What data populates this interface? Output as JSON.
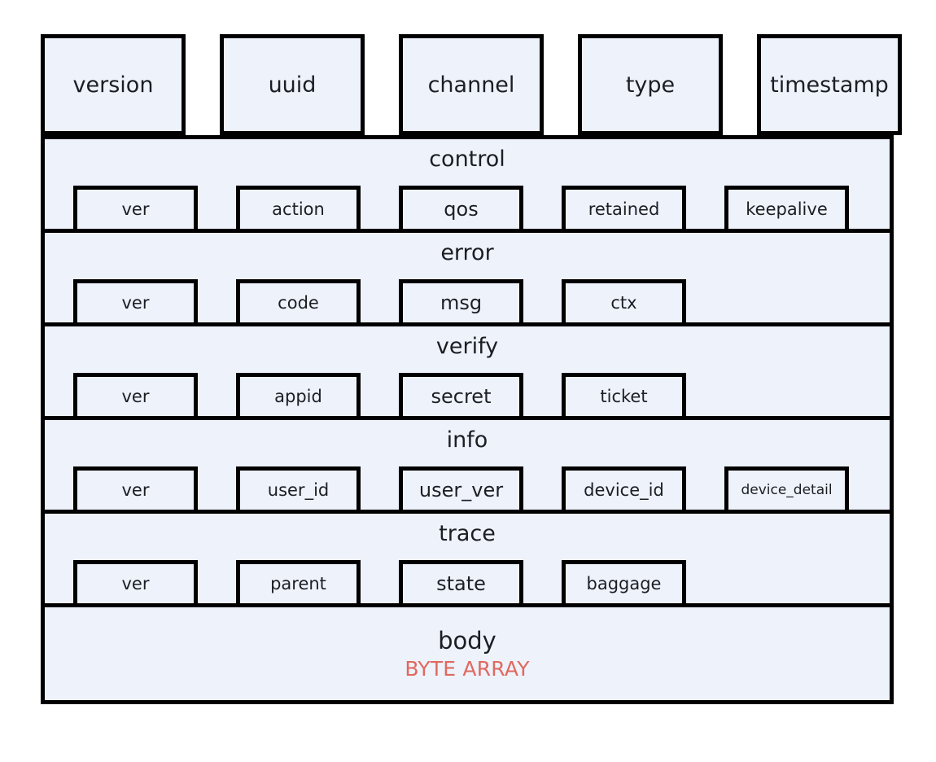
{
  "theme": {
    "fill": "#eef2fb",
    "border": "#000000",
    "text": "#1b1f24",
    "accent_red": "#e0695f",
    "background": "#ffffff"
  },
  "header": {
    "fields": [
      {
        "label": "version"
      },
      {
        "label": "uuid"
      },
      {
        "label": "channel"
      },
      {
        "label": "type"
      },
      {
        "label": "timestamp"
      }
    ]
  },
  "sections": [
    {
      "title": "control",
      "fields": [
        {
          "label": "ver"
        },
        {
          "label": "action"
        },
        {
          "label": "qos",
          "size": "lg"
        },
        {
          "label": "retained"
        },
        {
          "label": "keepalive"
        }
      ]
    },
    {
      "title": "error",
      "fields": [
        {
          "label": "ver"
        },
        {
          "label": "code"
        },
        {
          "label": "msg",
          "size": "lg"
        },
        {
          "label": "ctx"
        }
      ]
    },
    {
      "title": "verify",
      "fields": [
        {
          "label": "ver"
        },
        {
          "label": "appid"
        },
        {
          "label": "secret",
          "size": "lg"
        },
        {
          "label": "ticket"
        }
      ]
    },
    {
      "title": "info",
      "fields": [
        {
          "label": "ver"
        },
        {
          "label": "user_id"
        },
        {
          "label": "user_ver",
          "size": "lg"
        },
        {
          "label": "device_id"
        },
        {
          "label": "device_detail",
          "size": "sm"
        }
      ]
    },
    {
      "title": "trace",
      "fields": [
        {
          "label": "ver"
        },
        {
          "label": "parent"
        },
        {
          "label": "state",
          "size": "lg"
        },
        {
          "label": "baggage"
        }
      ]
    }
  ],
  "body": {
    "title": "body",
    "type_label": "BYTE ARRAY"
  }
}
